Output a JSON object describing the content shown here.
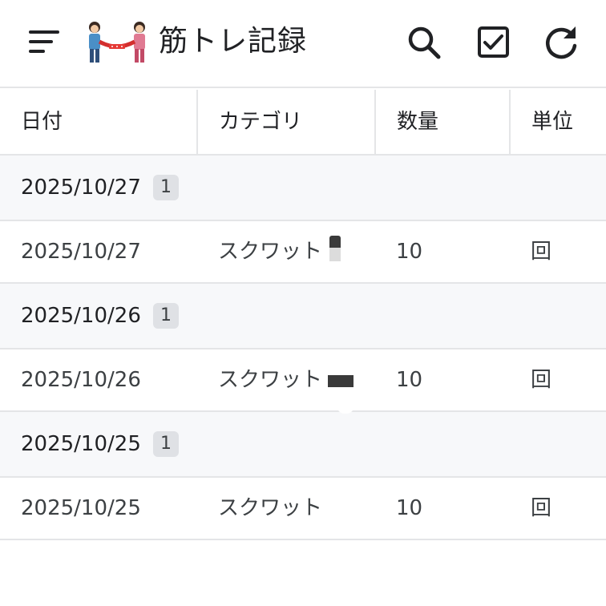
{
  "app": {
    "title": "筋トレ記録",
    "logo_icon": "tug-of-war-icon",
    "actions": [
      {
        "name": "search-button",
        "icon": "search-icon"
      },
      {
        "name": "select-button",
        "icon": "checkbox-icon"
      },
      {
        "name": "refresh-button",
        "icon": "refresh-icon"
      }
    ]
  },
  "table": {
    "headers": {
      "date": "日付",
      "category": "カテゴリ",
      "quantity": "数量",
      "unit": "単位"
    },
    "groups": [
      {
        "date": "2025/10/27",
        "count": "1",
        "rows": [
          {
            "date": "2025/10/27",
            "category": "スクワット",
            "quantity": "10",
            "unit": "回"
          }
        ]
      },
      {
        "date": "2025/10/26",
        "count": "1",
        "rows": [
          {
            "date": "2025/10/26",
            "category": "スクワット",
            "quantity": "10",
            "unit": "回"
          }
        ]
      },
      {
        "date": "2025/10/25",
        "count": "1",
        "rows": [
          {
            "date": "2025/10/25",
            "category": "スクワット",
            "quantity": "10",
            "unit": "回"
          }
        ]
      }
    ]
  },
  "colors": {
    "group_background": "#f7f8fa",
    "divider": "#e4e5e7",
    "badge_background": "#dfe1e5",
    "text": "#202124"
  }
}
